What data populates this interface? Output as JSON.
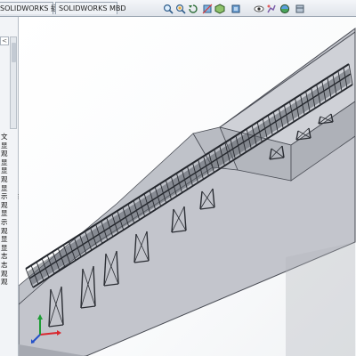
{
  "command_tabs": [
    {
      "label": "SOLIDWORKS 插件"
    },
    {
      "label": "SOLIDWORKS MBD"
    }
  ],
  "view_toolbar": {
    "icons": [
      "zoom-to-fit-icon",
      "zoom-area-icon",
      "previous-view-icon",
      "section-view-icon",
      "view-orientation-icon",
      "display-style-icon",
      "hide-show-icon",
      "edit-appearance-icon",
      "apply-scene-icon",
      "view-settings-icon"
    ]
  },
  "feature_tree": {
    "items": [
      "文",
      "显",
      "观",
      "显",
      "显",
      "观",
      "显",
      "示",
      "观",
      "显",
      "示",
      "观",
      "显",
      "显",
      "志",
      "志",
      "观",
      "观"
    ],
    "collapsed_glyph": "<"
  },
  "colors": {
    "tab_bg": "#eef1f5",
    "ground": "#c3c5cc",
    "truss": "#2a2d33",
    "axis_x": "#d9272e",
    "axis_y": "#1d9d35",
    "axis_z": "#2350c8"
  }
}
